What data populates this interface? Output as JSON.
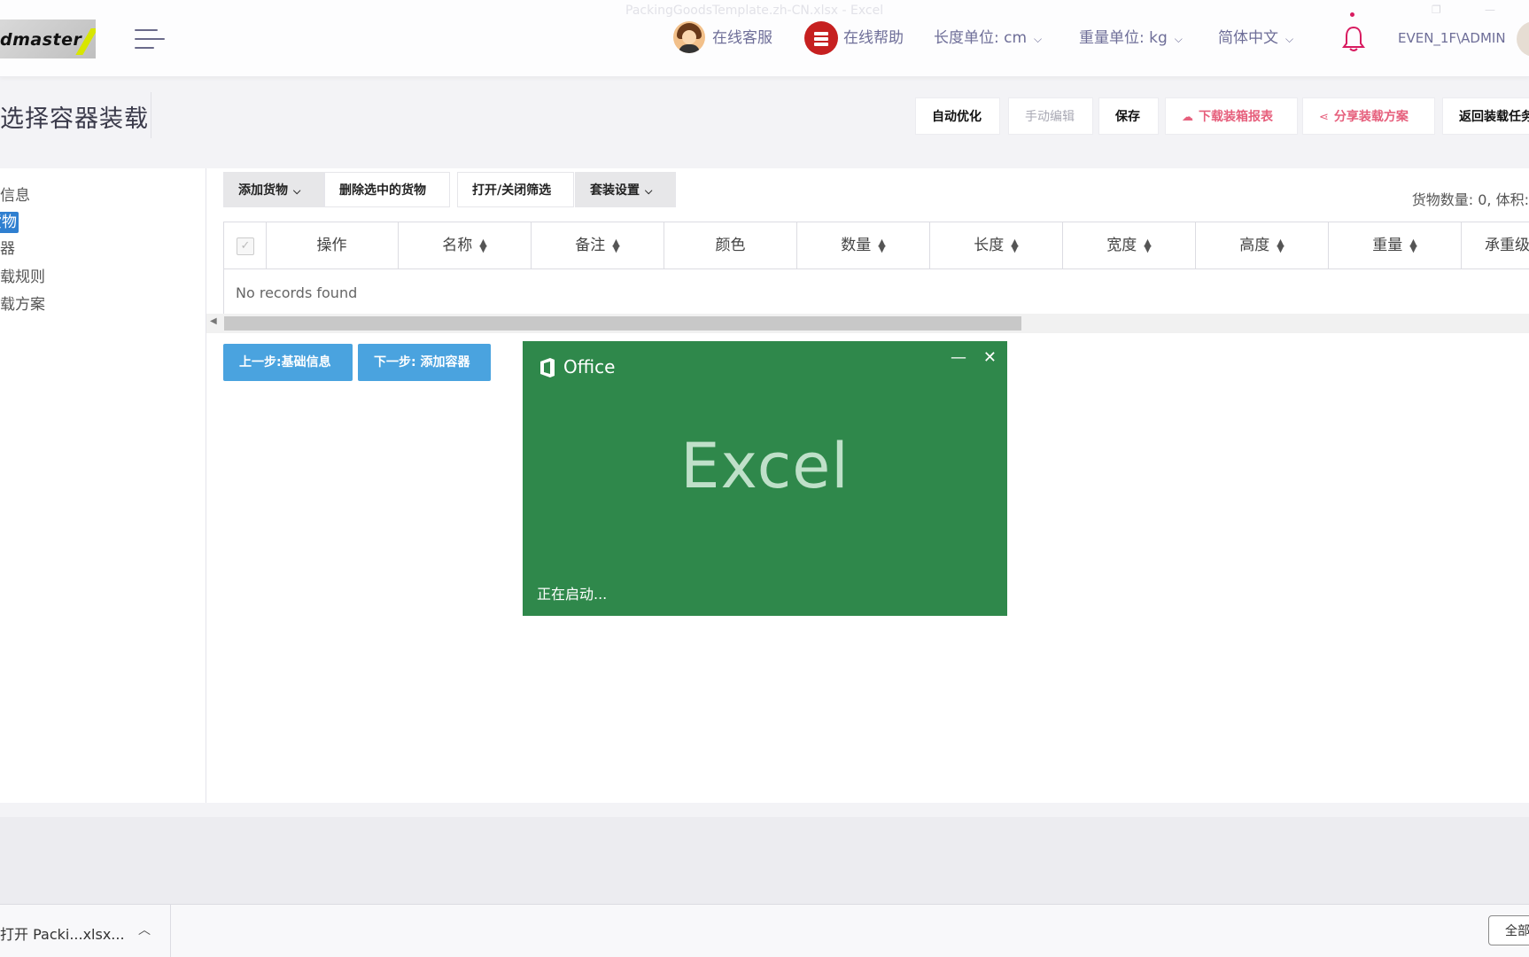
{
  "window": {
    "ghost_title": "PackingGoodsTemplate.zh-CN.xlsx - Excel"
  },
  "header": {
    "logo_text": "dmaster",
    "online_service": "在线客服",
    "online_help": "在线帮助",
    "length_unit": "长度单位: cm",
    "weight_unit": "重量单位: kg",
    "language": "简体中文",
    "user": "EVEN_1F\\ADMIN"
  },
  "page": {
    "title": "选择容器装载",
    "actions": {
      "auto_optimize": "自动优化",
      "manual_edit": "手动编辑",
      "save": "保存",
      "download_report": "下载装箱报表",
      "share_plan": "分享装载方案",
      "return": "返回装载任务"
    }
  },
  "sidebar": {
    "items": [
      {
        "label": "基础信息"
      },
      {
        "label": "货物"
      },
      {
        "label": "容器"
      },
      {
        "label": "装载规则"
      },
      {
        "label": "装载方案"
      }
    ]
  },
  "main": {
    "add_goods": "添加货物",
    "delete_selected": "删除选中的货物",
    "toggle_filter": "打开/关闭筛选",
    "kit_settings": "套装设置",
    "summary": "货物数量: 0, 体积:",
    "columns": [
      "操作",
      "名称",
      "备注",
      "颜色",
      "数量",
      "长度",
      "宽度",
      "高度",
      "重量",
      "承重级"
    ],
    "empty_text": "No records found",
    "prev_step": "上一步:基础信息",
    "next_step": "下一步: 添加容器"
  },
  "splash": {
    "brand": "Office",
    "app": "Excel",
    "status": "正在启动..."
  },
  "download_bar": {
    "item_label": "打开 Packi...xlsx...",
    "show_all": "全部"
  },
  "colors": {
    "accent_blue": "#4aa3df",
    "excel_green": "#2f884b",
    "header_text": "#6e6e98",
    "pink": "#e65f7c"
  }
}
